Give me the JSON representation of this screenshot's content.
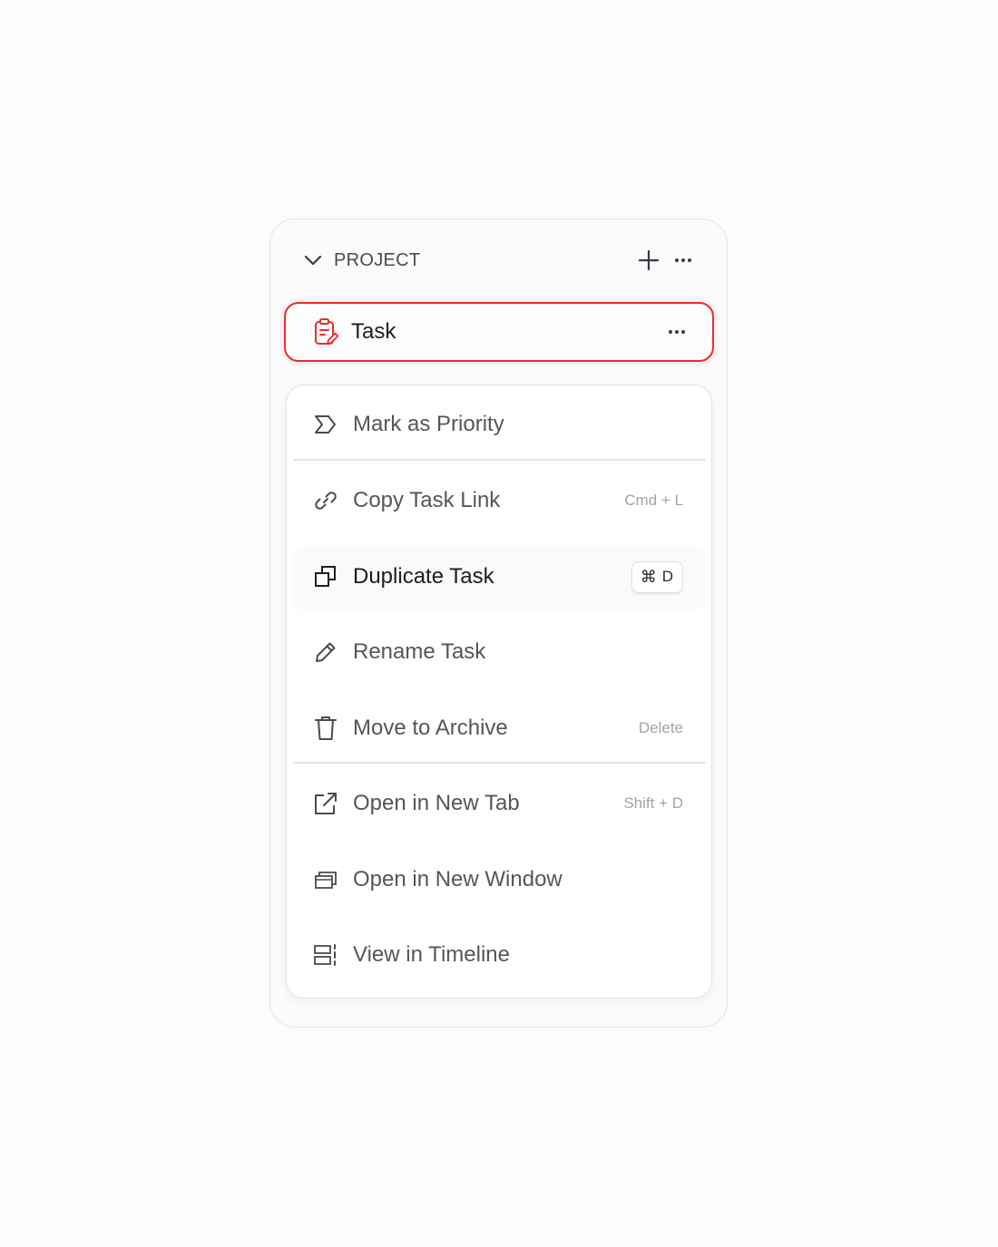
{
  "section": {
    "title": "PROJECT",
    "chevron_icon": "chevron-down-icon",
    "add_icon": "plus-icon",
    "more_icon": "more-horizontal-icon"
  },
  "task": {
    "label": "Task",
    "icon": "clipboard-edit-icon",
    "more_icon": "more-horizontal-icon",
    "accent_color": "#e5302b"
  },
  "menu": {
    "items": [
      {
        "label": "Mark as Priority",
        "icon": "priority-chevron-icon",
        "shortcut": ""
      },
      {
        "label": "Copy Task Link",
        "icon": "link-icon",
        "shortcut": "Cmd + L"
      },
      {
        "label": "Duplicate Task",
        "icon": "duplicate-icon",
        "shortcut_symbol": "⌘",
        "shortcut_key": "D",
        "hovered": true
      },
      {
        "label": "Rename Task",
        "icon": "pencil-icon",
        "shortcut": ""
      },
      {
        "label": "Move to Archive",
        "icon": "trash-icon",
        "shortcut": "Delete"
      },
      {
        "label": "Open in New Tab",
        "icon": "external-link-icon",
        "shortcut": "Shift + D"
      },
      {
        "label": "Open in New Window",
        "icon": "window-icon",
        "shortcut": ""
      },
      {
        "label": "View in Timeline",
        "icon": "timeline-icon",
        "shortcut": ""
      }
    ]
  }
}
